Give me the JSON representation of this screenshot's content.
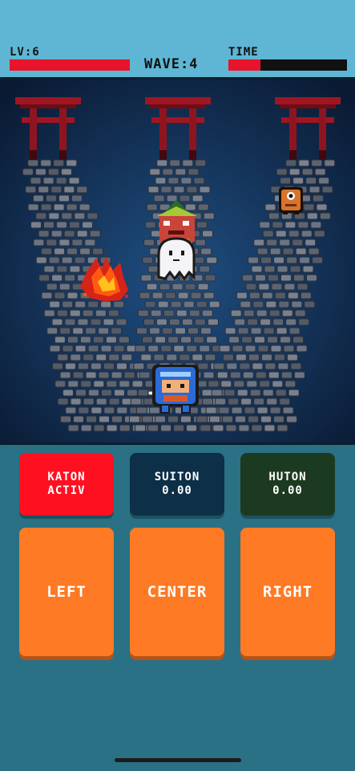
{
  "hud": {
    "level_label": "LV:6",
    "level_bar_fraction": 1.0,
    "wave_label": "WAVE:4",
    "time_label": "TIME",
    "time_bar_fraction": 0.27
  },
  "scene": {
    "gates": [
      "torii-gate",
      "torii-gate",
      "torii-gate"
    ],
    "characters": [
      "ninja-player",
      "ghost-enemy",
      "goblin-enemy",
      "one-eyed-enemy",
      "fire-effect"
    ]
  },
  "jutsu": [
    {
      "name": "KATON",
      "status": "ACTIV",
      "color": "#ff1021",
      "text_color": "#ffffff"
    },
    {
      "name": "SUITON",
      "status": "0.00",
      "color": "#0d2f47",
      "text_color": "#ffffff"
    },
    {
      "name": "HUTON",
      "status": "0.00",
      "color": "#1c3a1f",
      "text_color": "#ffffff"
    }
  ],
  "lanes": [
    "LEFT",
    "CENTER",
    "RIGHT"
  ],
  "colors": {
    "accent": "#e8142b",
    "button": "#ff7a24",
    "panel": "#2a7185",
    "top": "#5fb6d4"
  }
}
